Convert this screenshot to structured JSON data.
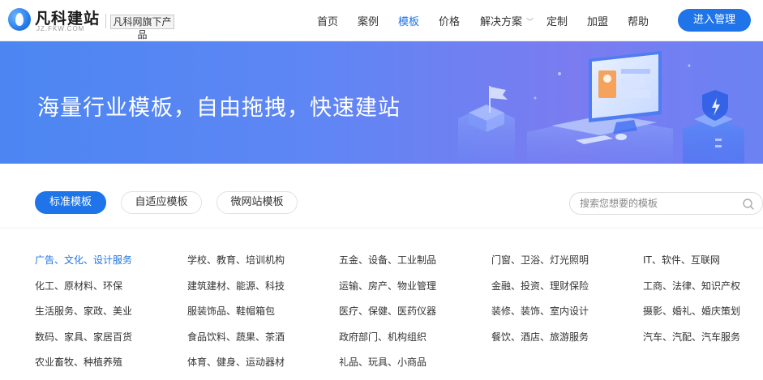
{
  "header": {
    "logo_text": "凡科建站",
    "logo_subtext": "JZ.FKW.COM",
    "brand_tag": "凡科网旗下产品",
    "nav": [
      {
        "label": "首页"
      },
      {
        "label": "案例"
      },
      {
        "label": "模板",
        "active": true
      },
      {
        "label": "价格"
      },
      {
        "label": "解决方案",
        "dropdown": true
      },
      {
        "label": "定制"
      },
      {
        "label": "加盟"
      },
      {
        "label": "帮助"
      }
    ],
    "enter_button": "进入管理",
    "accent_color": "#1e74e8"
  },
  "banner": {
    "title": "海量行业模板，自由拖拽，快速建站"
  },
  "tabs": [
    {
      "label": "标准模板",
      "active": true
    },
    {
      "label": "自适应模板"
    },
    {
      "label": "微网站模板"
    }
  ],
  "search": {
    "placeholder": "搜索您想要的模板"
  },
  "categories": [
    [
      "广告、文化、设计服务",
      "学校、教育、培训机构",
      "五金、设备、工业制品",
      "门窗、卫浴、灯光照明",
      "IT、软件、互联网"
    ],
    [
      "化工、原材料、环保",
      "建筑建材、能源、科技",
      "运输、房产、物业管理",
      "金融、投资、理财保险",
      "工商、法律、知识产权"
    ],
    [
      "生活服务、家政、美业",
      "服装饰品、鞋帽箱包",
      "医疗、保健、医药仪器",
      "装修、装饰、室内设计",
      "摄影、婚礼、婚庆策划"
    ],
    [
      "数码、家具、家居百货",
      "食品饮料、蔬果、茶酒",
      "政府部门、机构组织",
      "餐饮、酒店、旅游服务",
      "汽车、汽配、汽车服务"
    ],
    [
      "农业畜牧、种植养殖",
      "体育、健身、运动器材",
      "礼品、玩具、小商品"
    ]
  ],
  "active_category": "广告、文化、设计服务"
}
